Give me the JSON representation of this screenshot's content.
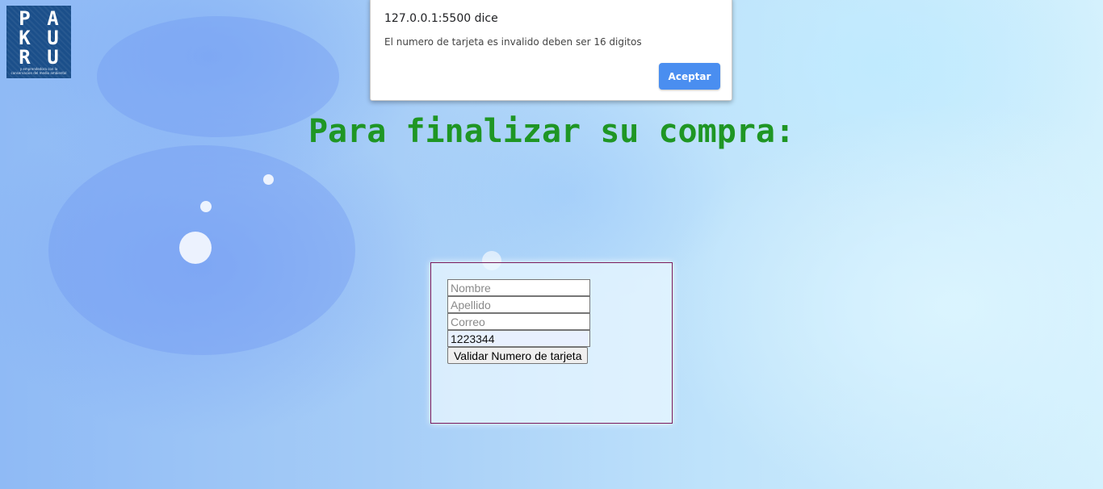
{
  "logo": {
    "letters": [
      "P",
      "A",
      "K",
      "U",
      "R",
      "U"
    ],
    "tagline": "y emprendedora con la conservacion del medio ambiental"
  },
  "dialog": {
    "origin": "127.0.0.1:5500 dice",
    "message": "El numero de tarjeta es invalido deben ser 16 digitos",
    "ok_label": "Aceptar"
  },
  "page": {
    "heading": "Para finalizar su compra:"
  },
  "form": {
    "nombre_placeholder": "Nombre",
    "apellido_placeholder": "Apellido",
    "correo_placeholder": "Correo",
    "tarjeta_value": "1223344",
    "validate_label": "Validar Numero de tarjeta"
  },
  "colors": {
    "heading": "#1f9624",
    "dialog_button": "#4a8ef0",
    "form_border": "#7a1a5a"
  }
}
